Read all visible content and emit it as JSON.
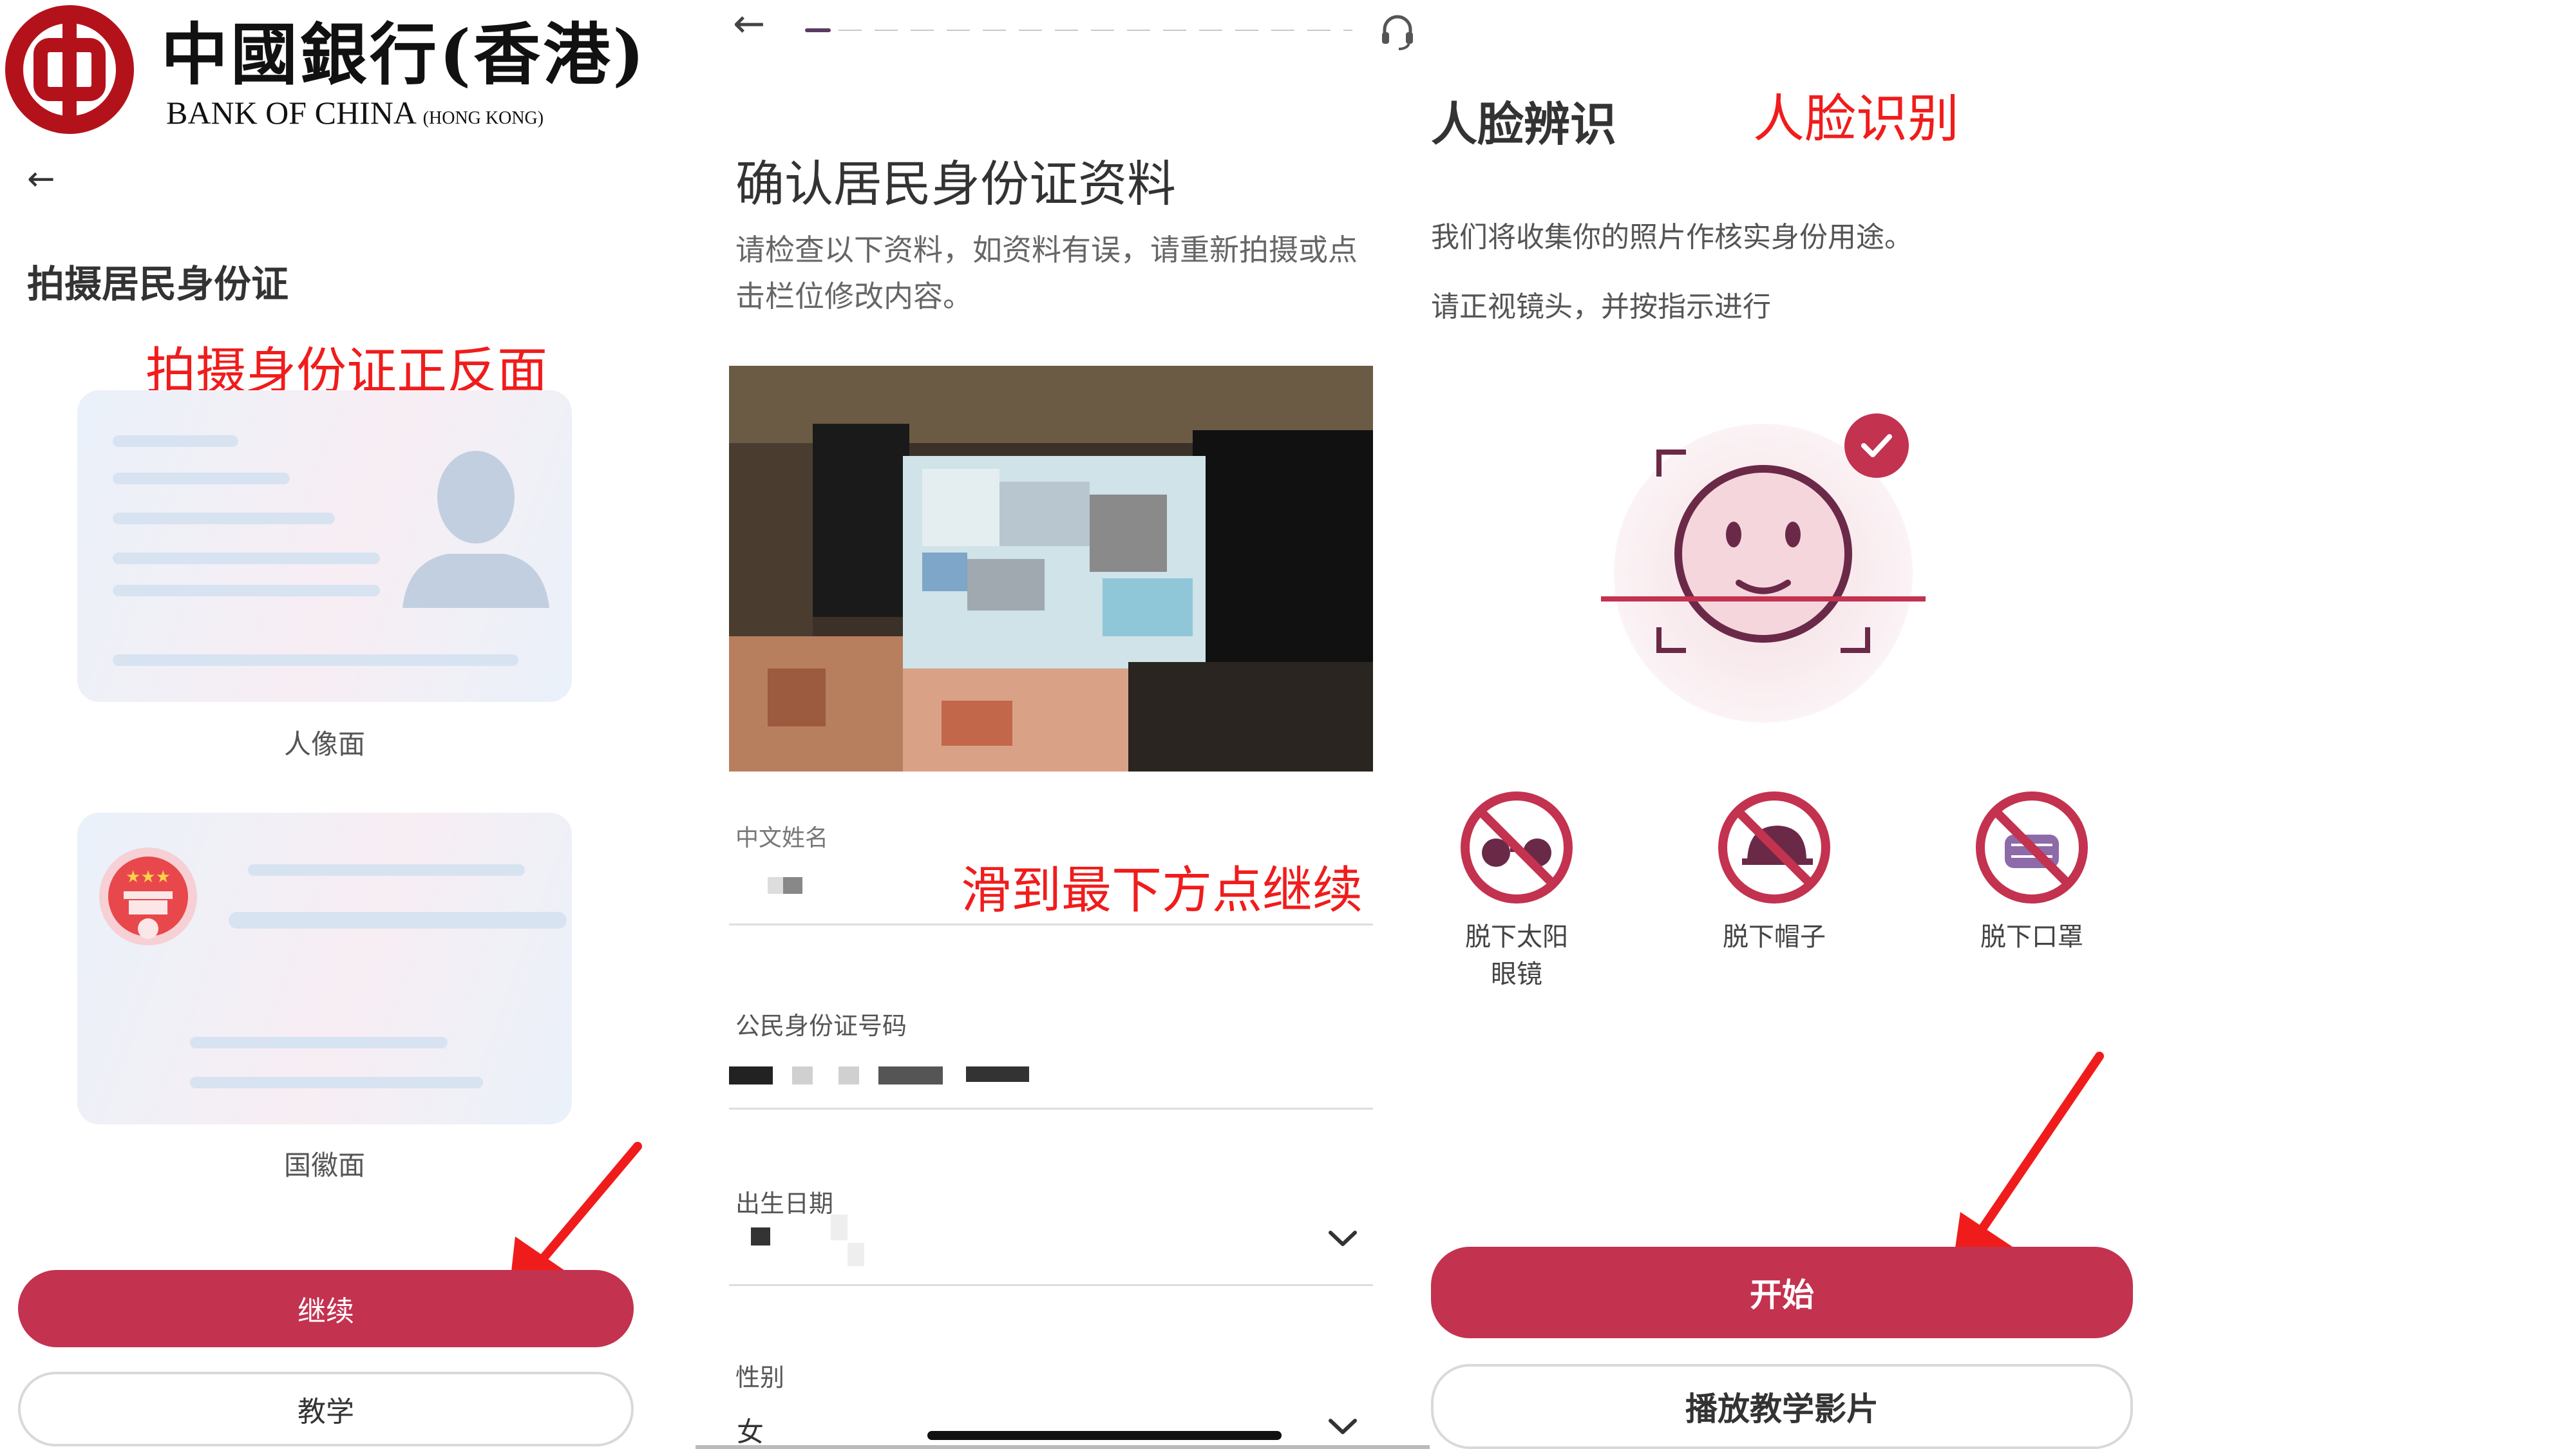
{
  "panel1": {
    "logo": {
      "chinese": "中國銀行(香港)",
      "english": "BANK OF CHINA",
      "english_suffix": "(HONG KONG)"
    },
    "back_icon": "arrow-left-icon",
    "title": "拍摄居民身份证",
    "annotation": "拍摄身份证正反面",
    "card_front_label": "人像面",
    "card_back_label": "国徽面",
    "continue_label": "继续",
    "tutorial_label": "教学"
  },
  "panel2": {
    "back_icon": "arrow-left-icon",
    "support_icon": "headset-icon",
    "progress": {
      "current_step": 1,
      "total_steps": 13
    },
    "title": "确认居民身份证资料",
    "description": "请检查以下资料，如资料有误，请重新拍摄或点击栏位修改内容。",
    "annotation": "滑到最下方点继续",
    "fields": [
      {
        "label": "中文姓名"
      },
      {
        "label": "公民身份证号码"
      },
      {
        "label": "出生日期"
      },
      {
        "label": "性别",
        "value": "女"
      }
    ]
  },
  "panel3": {
    "title": "人脸辨识",
    "annotation": "人脸识别",
    "line1": "我们将收集你的照片作核实身份用途。",
    "line2": "请正视镜头，并按指示进行",
    "tips": [
      {
        "icon": "no-sunglasses-icon",
        "label": "脱下太阳眼镜"
      },
      {
        "icon": "no-hat-icon",
        "label": "脱下帽子"
      },
      {
        "icon": "no-mask-icon",
        "label": "脱下口罩"
      }
    ],
    "start_label": "开始",
    "video_label": "播放教学影片"
  },
  "colors": {
    "brand": "#c3324f",
    "annotation": "#f01c1c",
    "brand_logo": "#b4121b"
  }
}
